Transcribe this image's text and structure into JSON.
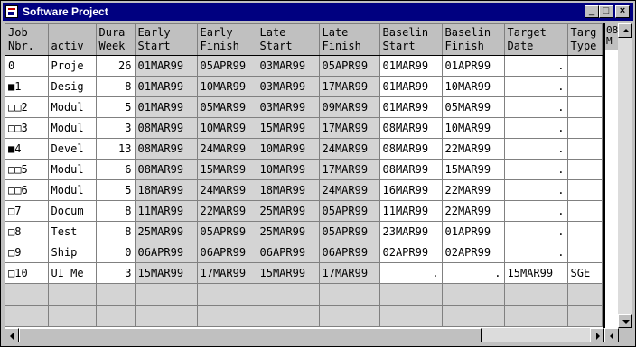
{
  "window": {
    "title": "Software Project"
  },
  "columns": [
    {
      "key": "job",
      "label": "Job\nNbr."
    },
    {
      "key": "activ",
      "label": "\nactiv"
    },
    {
      "key": "dur",
      "label": "Dura\nWeek"
    },
    {
      "key": "es",
      "label": "Early\nStart"
    },
    {
      "key": "ef",
      "label": "Early\nFinish"
    },
    {
      "key": "ls",
      "label": "Late\nStart"
    },
    {
      "key": "lf",
      "label": "Late\nFinish"
    },
    {
      "key": "bs",
      "label": "Baselin\nStart"
    },
    {
      "key": "bf",
      "label": "Baselin\nFinish"
    },
    {
      "key": "td",
      "label": "Target\nDate"
    },
    {
      "key": "tt",
      "label": "Targ\nType"
    }
  ],
  "rows": [
    {
      "job": "0",
      "activ": "Proje",
      "dur": "26",
      "es": "01MAR99",
      "ef": "05APR99",
      "ls": "03MAR99",
      "lf": "05APR99",
      "bs": "01MAR99",
      "bf": "01APR99",
      "td": ".",
      "tt": ""
    },
    {
      "job": "■1",
      "activ": "Desig",
      "dur": "8",
      "es": "01MAR99",
      "ef": "10MAR99",
      "ls": "03MAR99",
      "lf": "17MAR99",
      "bs": "01MAR99",
      "bf": "10MAR99",
      "td": ".",
      "tt": ""
    },
    {
      "job": "□□2",
      "activ": "Modul",
      "dur": "5",
      "es": "01MAR99",
      "ef": "05MAR99",
      "ls": "03MAR99",
      "lf": "09MAR99",
      "bs": "01MAR99",
      "bf": "05MAR99",
      "td": ".",
      "tt": ""
    },
    {
      "job": "□□3",
      "activ": "Modul",
      "dur": "3",
      "es": "08MAR99",
      "ef": "10MAR99",
      "ls": "15MAR99",
      "lf": "17MAR99",
      "bs": "08MAR99",
      "bf": "10MAR99",
      "td": ".",
      "tt": ""
    },
    {
      "job": "■4",
      "activ": "Devel",
      "dur": "13",
      "es": "08MAR99",
      "ef": "24MAR99",
      "ls": "10MAR99",
      "lf": "24MAR99",
      "bs": "08MAR99",
      "bf": "22MAR99",
      "td": ".",
      "tt": ""
    },
    {
      "job": "□□5",
      "activ": "Modul",
      "dur": "6",
      "es": "08MAR99",
      "ef": "15MAR99",
      "ls": "10MAR99",
      "lf": "17MAR99",
      "bs": "08MAR99",
      "bf": "15MAR99",
      "td": ".",
      "tt": ""
    },
    {
      "job": "□□6",
      "activ": "Modul",
      "dur": "5",
      "es": "18MAR99",
      "ef": "24MAR99",
      "ls": "18MAR99",
      "lf": "24MAR99",
      "bs": "16MAR99",
      "bf": "22MAR99",
      "td": ".",
      "tt": ""
    },
    {
      "job": "□7",
      "activ": "Docum",
      "dur": "8",
      "es": "11MAR99",
      "ef": "22MAR99",
      "ls": "25MAR99",
      "lf": "05APR99",
      "bs": "11MAR99",
      "bf": "22MAR99",
      "td": ".",
      "tt": ""
    },
    {
      "job": "□8",
      "activ": "Test",
      "dur": "8",
      "es": "25MAR99",
      "ef": "05APR99",
      "ls": "25MAR99",
      "lf": "05APR99",
      "bs": "23MAR99",
      "bf": "01APR99",
      "td": ".",
      "tt": ""
    },
    {
      "job": "□9",
      "activ": "Ship",
      "dur": "0",
      "es": "06APR99",
      "ef": "06APR99",
      "ls": "06APR99",
      "lf": "06APR99",
      "bs": "02APR99",
      "bf": "02APR99",
      "td": ".",
      "tt": ""
    },
    {
      "job": "□10",
      "activ": "UI Me",
      "dur": "3",
      "es": "15MAR99",
      "ef": "17MAR99",
      "ls": "15MAR99",
      "lf": "17MAR99",
      "bs": ".",
      "bf": ".",
      "td": "15MAR99",
      "tt": "SGE"
    }
  ],
  "empty_rows": 2,
  "right_strip_header": "08\nM",
  "colors": {
    "titlebar": "#000080",
    "shaded": "#d4d4d4",
    "face": "#c0c0c0"
  }
}
